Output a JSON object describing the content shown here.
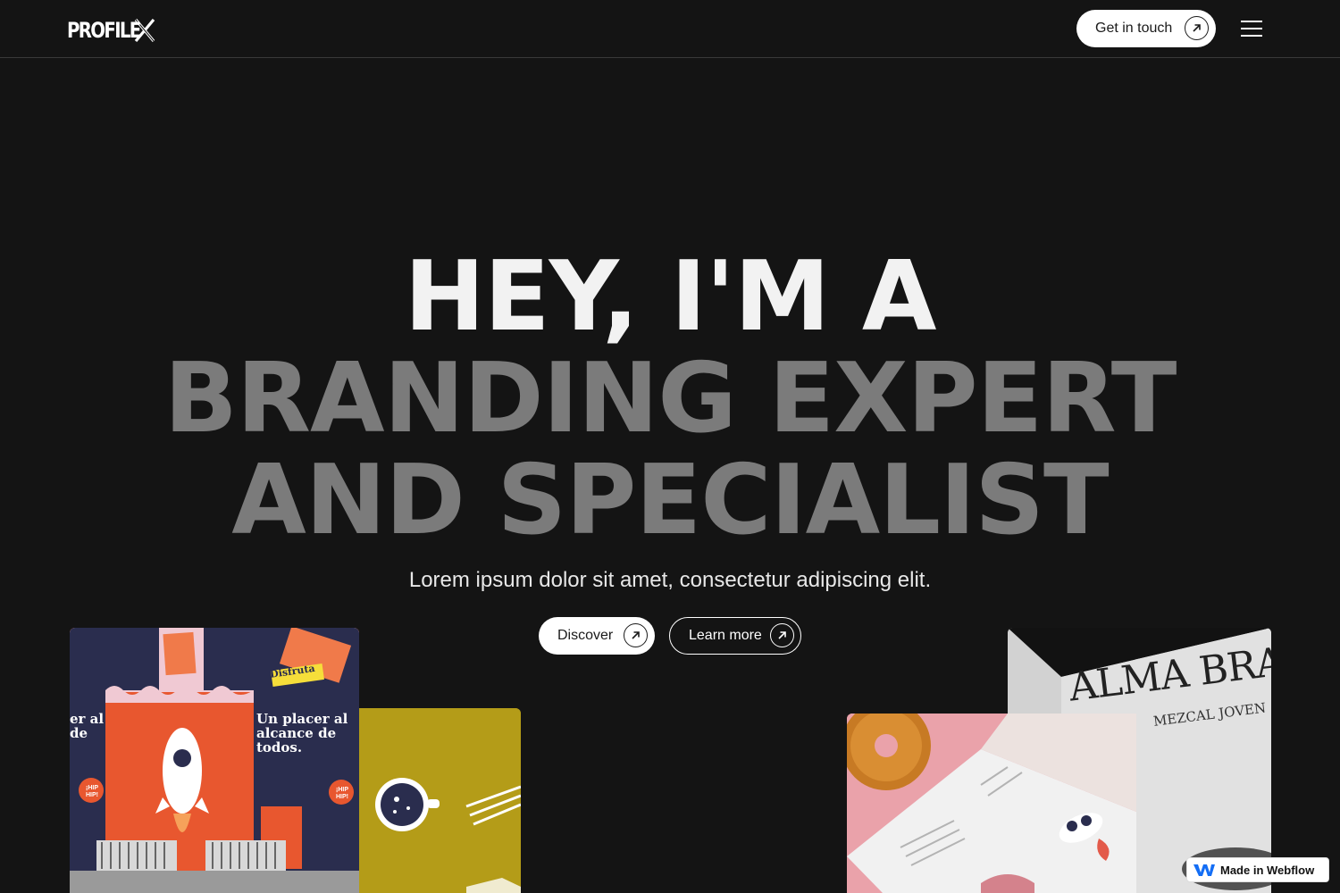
{
  "header": {
    "logo_text": "PROFILE",
    "cta_label": "Get in touch",
    "menu_icon": "hamburger-menu-icon"
  },
  "hero": {
    "headline_line1": "HEY, I'M A",
    "headline_line2": "BRANDING EXPERT",
    "headline_line3": "AND SPECIALIST",
    "subtitle": "Lorem ipsum dolor sit amet, consectetur adipiscing elit.",
    "primary_button": "Discover",
    "secondary_button": "Learn more"
  },
  "gallery": {
    "poster_headline": "Un placer al alcance de todos.",
    "poster_headline_cut": "er al de",
    "poster_sticker": "Disfruta",
    "poster_badge": "¡HIP HIP!",
    "alma_title": "ALMA BRA",
    "alma_subtitle": "MEZCAL JOVEN"
  },
  "badge": {
    "label": "Made in Webflow"
  },
  "colors": {
    "background": "#141414",
    "headline_primary": "#f2f2f2",
    "headline_muted": "#7b7b7b",
    "button_light": "#ffffff",
    "poster_orange": "#e8572f",
    "poster_navy": "#2a2d4e",
    "mustard": "#b49c18",
    "pink": "#e9a1a9"
  }
}
